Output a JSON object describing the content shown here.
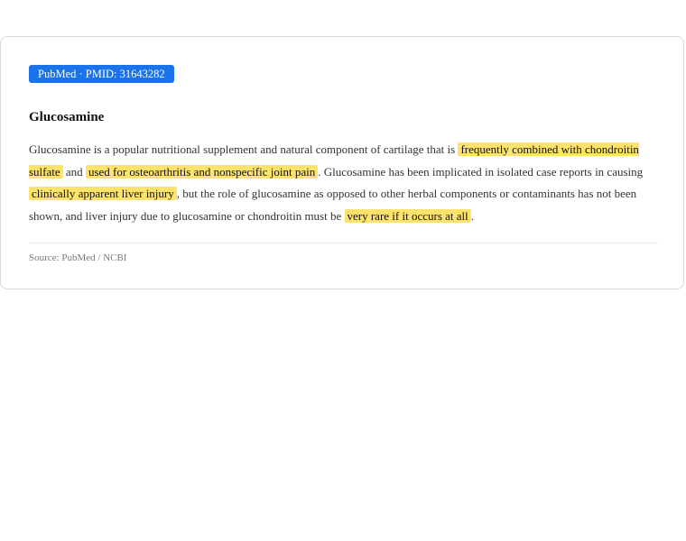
{
  "badge": "PubMed · PMID: 31643282",
  "title": "Glucosamine",
  "abstract": {
    "t1": "Glucosamine is a popular nutritional supplement and natural component of cartilage that is ",
    "h1": "frequently combined with chondroitin sulfate",
    "t2": " and ",
    "h2": "used for osteoarthritis and nonspecific joint pain",
    "t3": ". Glucosamine has been implicated in isolated case reports in causing ",
    "h3": "clinically apparent liver injury",
    "t4": ", but the role of glucosamine as opposed to other herbal components or contaminants has not been shown, and liver injury due to glucosamine or chondroitin must be ",
    "h4": "very rare if it occurs at all",
    "t5": "."
  },
  "source": "Source: PubMed / NCBI",
  "colors": {
    "badge": "#1a73e8",
    "highlight": "#fde26b"
  }
}
